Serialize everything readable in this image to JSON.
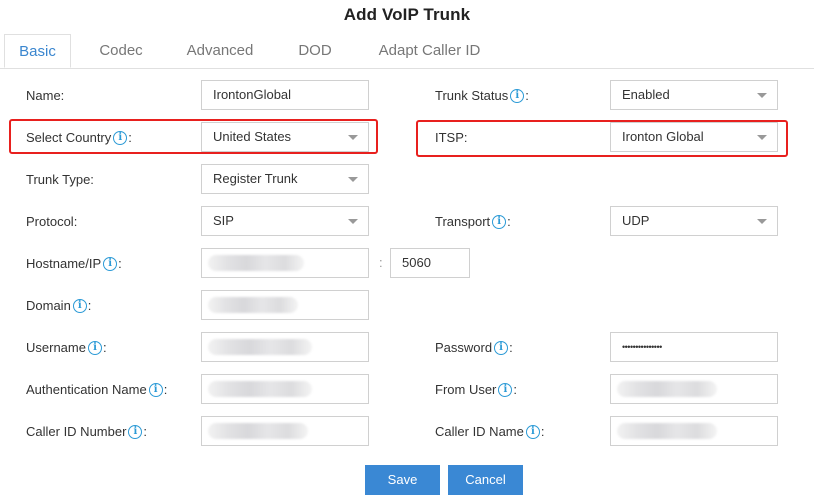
{
  "dialog": {
    "title": "Add VoIP Trunk"
  },
  "tabs": [
    {
      "label": "Basic",
      "active": true
    },
    {
      "label": "Codec",
      "active": false
    },
    {
      "label": "Advanced",
      "active": false
    },
    {
      "label": "DOD",
      "active": false
    },
    {
      "label": "Adapt Caller ID",
      "active": false
    }
  ],
  "fields": {
    "name": {
      "label": "Name:",
      "value": "IrontonGlobal"
    },
    "trunk_status": {
      "label": "Trunk Status",
      "value": "Enabled"
    },
    "select_country": {
      "label": "Select Country",
      "value": "United States"
    },
    "itsp": {
      "label": "ITSP:",
      "value": "Ironton Global"
    },
    "trunk_type": {
      "label": "Trunk Type:",
      "value": "Register Trunk"
    },
    "protocol": {
      "label": "Protocol:",
      "value": "SIP"
    },
    "transport": {
      "label": "Transport",
      "value": "UDP"
    },
    "hostname": {
      "label": "Hostname/IP",
      "value": "",
      "port": "5060",
      "port_separator": ":"
    },
    "domain": {
      "label": "Domain",
      "value": ""
    },
    "username": {
      "label": "Username",
      "value": ""
    },
    "password": {
      "label": "Password",
      "value": "•••••••••••••••"
    },
    "auth_name": {
      "label": "Authentication Name",
      "value": ""
    },
    "from_user": {
      "label": "From User",
      "value": ""
    },
    "caller_id_number": {
      "label": "Caller ID Number",
      "value": ""
    },
    "caller_id_name": {
      "label": "Caller ID Name",
      "value": ""
    }
  },
  "icons": {
    "info": "i",
    "colon": ":"
  },
  "buttons": {
    "save": "Save",
    "cancel": "Cancel"
  },
  "colors": {
    "accent": "#3a88d4",
    "highlight": "#e8201e",
    "info_icon": "#2b9ad6"
  }
}
